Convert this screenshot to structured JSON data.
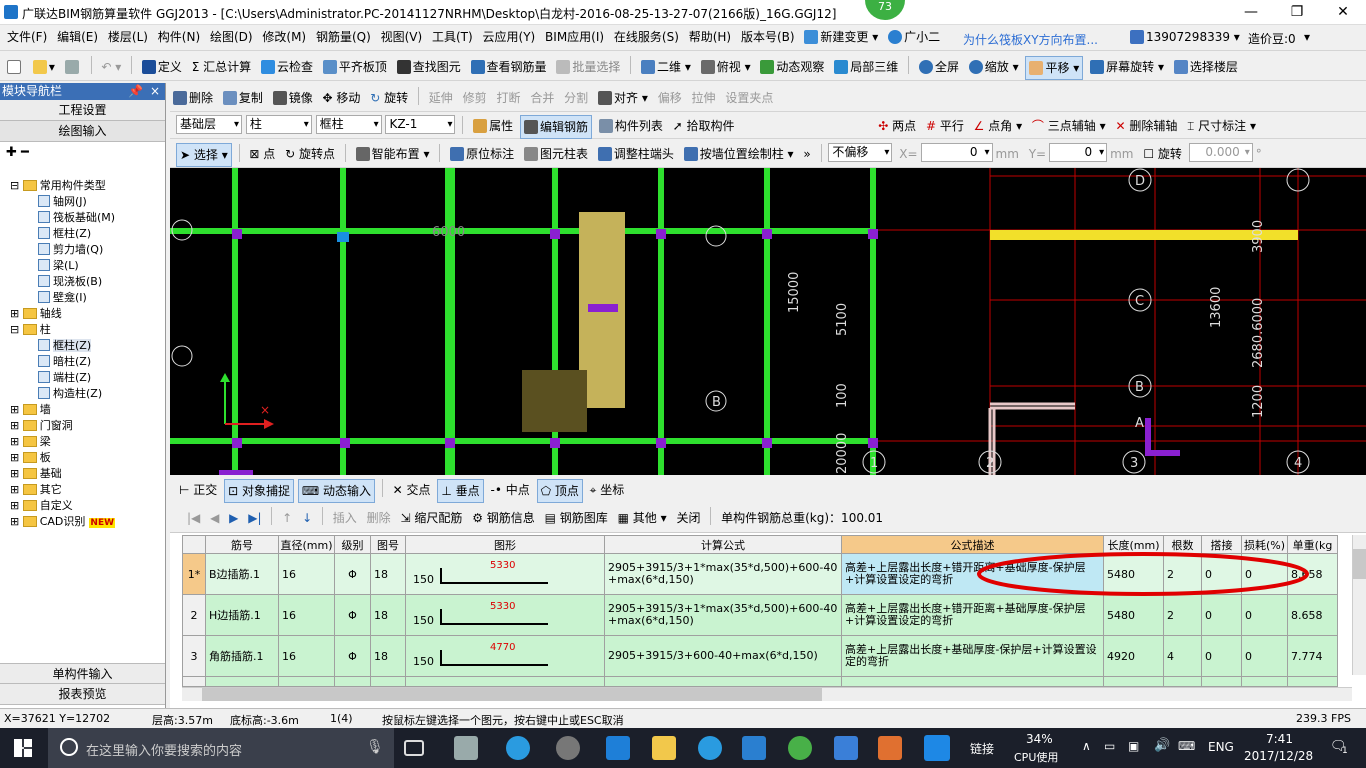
{
  "title": {
    "text": "广联达BIM钢筋算量软件 GGJ2013 - [C:\\Users\\Administrator.PC-20141127NRHM\\Desktop\\白龙村-2016-08-25-13-27-07(2166版)_16G.GGJ12]",
    "badge": "73"
  },
  "menu": [
    "文件(F)",
    "编辑(E)",
    "楼层(L)",
    "构件(N)",
    "绘图(D)",
    "修改(M)",
    "钢筋量(Q)",
    "视图(V)",
    "工具(T)",
    "云应用(Y)",
    "BIM应用(I)",
    "在线服务(S)",
    "帮助(H)",
    "版本号(B)",
    "新建变更",
    "广小二"
  ],
  "menu_right": {
    "question": "为什么筏板XY方向布置...",
    "phone": "13907298339",
    "price": "造价豆:0"
  },
  "toolbar1": [
    "定义",
    "汇总计算",
    "云检查",
    "平齐板顶",
    "查找图元",
    "查看钢筋量",
    "批量选择",
    "二维",
    "俯视",
    "动态观察",
    "局部三维",
    "全屏",
    "缩放",
    "平移",
    "屏幕旋转",
    "选择楼层"
  ],
  "panel_title": "模块导航栏",
  "toolbar2": [
    "删除",
    "复制",
    "镜像",
    "移动",
    "旋转",
    "延伸",
    "修剪",
    "打断",
    "合并",
    "分割",
    "对齐",
    "偏移",
    "拉伸",
    "设置夹点"
  ],
  "toolbar3": {
    "floor": "基础层",
    "cat": "柱",
    "sub": "框柱",
    "comp": "KZ-1",
    "btns": [
      "属性",
      "编辑钢筋",
      "构件列表",
      "拾取构件"
    ],
    "right": [
      "两点",
      "平行",
      "点角",
      "三点辅轴",
      "删除辅轴",
      "尺寸标注"
    ]
  },
  "toolbar4": {
    "btns": [
      "选择",
      "点",
      "旋转点",
      "智能布置",
      "原位标注",
      "图元柱表",
      "调整柱端头",
      "按墙位置绘制柱"
    ],
    "offset": "不偏移",
    "x_label": "X=",
    "x_val": "0",
    "unit": "mm",
    "y_label": "Y=",
    "y_val": "0",
    "unit2": "mm",
    "rot_label": "旋转",
    "rot_val": "0.000"
  },
  "nav": {
    "btn1": "工程设置",
    "btn2": "绘图输入",
    "btn3": "单构件输入",
    "btn4": "报表预览",
    "tree": [
      {
        "label": "常用构件类型",
        "type": "folder",
        "level": 0
      },
      {
        "label": "轴网(J)",
        "type": "item",
        "level": 1
      },
      {
        "label": "筏板基础(M)",
        "type": "item",
        "level": 1
      },
      {
        "label": "框柱(Z)",
        "type": "item",
        "level": 1
      },
      {
        "label": "剪力墙(Q)",
        "type": "item",
        "level": 1
      },
      {
        "label": "梁(L)",
        "type": "item",
        "level": 1
      },
      {
        "label": "现浇板(B)",
        "type": "item",
        "level": 1
      },
      {
        "label": "壁龛(I)",
        "type": "item",
        "level": 1
      },
      {
        "label": "轴线",
        "type": "folder",
        "level": 0
      },
      {
        "label": "柱",
        "type": "folder",
        "level": 0
      },
      {
        "label": "框柱(Z)",
        "type": "item",
        "level": 1
      },
      {
        "label": "暗柱(Z)",
        "type": "item",
        "level": 1
      },
      {
        "label": "端柱(Z)",
        "type": "item",
        "level": 1
      },
      {
        "label": "构造柱(Z)",
        "type": "item",
        "level": 1
      },
      {
        "label": "墙",
        "type": "folder",
        "level": 0
      },
      {
        "label": "门窗洞",
        "type": "folder",
        "level": 0
      },
      {
        "label": "梁",
        "type": "folder",
        "level": 0
      },
      {
        "label": "板",
        "type": "folder",
        "level": 0
      },
      {
        "label": "基础",
        "type": "folder",
        "level": 0
      },
      {
        "label": "其它",
        "type": "folder",
        "level": 0
      },
      {
        "label": "自定义",
        "type": "folder",
        "level": 0
      },
      {
        "label": "CAD识别",
        "type": "folder",
        "level": 0
      }
    ],
    "new_tag": "NEW"
  },
  "canvas_labels": {
    "d1": "6000",
    "d2": "15000",
    "d3": "5100",
    "d4": "100",
    "d5": "20000",
    "d6": "13600",
    "d7": "2680.6000",
    "d8": "3900",
    "d9": "1200",
    "axisB": "B",
    "axisC": "C",
    "axisD": "D",
    "axisA": "A",
    "n1": "1",
    "n2": "2",
    "n3": "3",
    "n4": "4"
  },
  "snapbar": [
    "正交",
    "对象捕捉",
    "动态输入",
    "交点",
    "垂点",
    "中点",
    "顶点",
    "坐标"
  ],
  "grid_toolbar": {
    "btns": [
      "插入",
      "删除",
      "缩尺配筋",
      "钢筋信息",
      "钢筋图库",
      "其他",
      "关闭"
    ],
    "total": "单构件钢筋总重(kg)：100.01"
  },
  "grid_headers": [
    "",
    "筋号",
    "直径(mm)",
    "级别",
    "图号",
    "图形",
    "计算公式",
    "公式描述",
    "长度(mm)",
    "根数",
    "搭接",
    "损耗(%)",
    "单重(kg"
  ],
  "grid_rows": [
    {
      "idx": "1*",
      "name": "B边插筋.1",
      "dia": "16",
      "grade": "Φ",
      "fig": "18",
      "hook": "150",
      "len_label": "5330",
      "formula": "2905+3915/3+1*max(35*d,500)+600-40+max(6*d,150)",
      "desc": "高差+上层露出长度+错开距离+基础厚度-保护层+计算设置设定的弯折",
      "length": "5480",
      "count": "2",
      "lap": "0",
      "loss": "0",
      "weight": "8.658"
    },
    {
      "idx": "2",
      "name": "H边插筋.1",
      "dia": "16",
      "grade": "Φ",
      "fig": "18",
      "hook": "150",
      "len_label": "5330",
      "formula": "2905+3915/3+1*max(35*d,500)+600-40+max(6*d,150)",
      "desc": "高差+上层露出长度+错开距离+基础厚度-保护层+计算设置设定的弯折",
      "length": "5480",
      "count": "2",
      "lap": "0",
      "loss": "0",
      "weight": "8.658"
    },
    {
      "idx": "3",
      "name": "角筋插筋.1",
      "dia": "16",
      "grade": "Φ",
      "fig": "18",
      "hook": "150",
      "len_label": "4770",
      "formula": "2905+3915/3+600-40+max(6*d,150)",
      "desc": "高差+上层露出长度+基础厚度-保护层+计算设置设定的弯折",
      "length": "4920",
      "count": "4",
      "lap": "0",
      "loss": "0",
      "weight": "7.774"
    }
  ],
  "status": {
    "coord": "X=37621 Y=12702",
    "floor_h": "层高:3.57m",
    "bottom_h": "底标高:-3.6m",
    "count": "1(4)",
    "hint": "按鼠标左键选择一个图元，按右键中止或ESC取消",
    "fps": "239.3 FPS"
  },
  "taskbar": {
    "search": "在这里输入你要搜索的内容",
    "link": "链接",
    "cpu_pct": "34%",
    "cpu": "CPU使用",
    "lang": "ENG",
    "time": "7:41",
    "date": "2017/12/28",
    "notif": "1"
  }
}
